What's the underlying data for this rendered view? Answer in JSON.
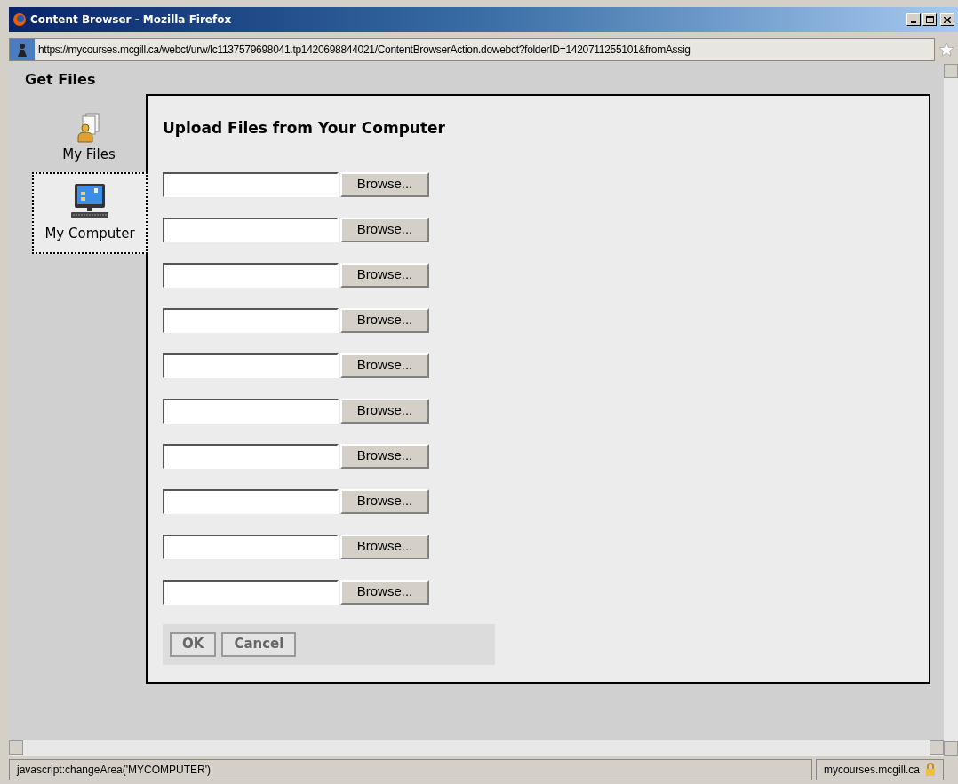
{
  "window": {
    "title": "Content Browser - Mozilla Firefox"
  },
  "address_bar": {
    "url": "https://mycourses.mcgill.ca/webct/urw/lc1137579698041.tp1420698844021/ContentBrowserAction.dowebct?folderID=1420711255101&fromAssig"
  },
  "page": {
    "heading": "Get Files",
    "sidebar": {
      "items": [
        {
          "label": "My Files",
          "kind": "files",
          "selected": false
        },
        {
          "label": "My Computer",
          "kind": "computer",
          "selected": true
        }
      ]
    },
    "panel": {
      "title": "Upload Files from Your Computer",
      "file_rows": [
        {
          "button": "Browse..."
        },
        {
          "button": "Browse..."
        },
        {
          "button": "Browse..."
        },
        {
          "button": "Browse..."
        },
        {
          "button": "Browse..."
        },
        {
          "button": "Browse..."
        },
        {
          "button": "Browse..."
        },
        {
          "button": "Browse..."
        },
        {
          "button": "Browse..."
        },
        {
          "button": "Browse..."
        }
      ],
      "buttons": [
        "OK",
        "Cancel"
      ]
    }
  },
  "status_bar": {
    "text": "javascript:changeArea('MYCOMPUTER')",
    "domain": "mycourses.mcgill.ca"
  }
}
